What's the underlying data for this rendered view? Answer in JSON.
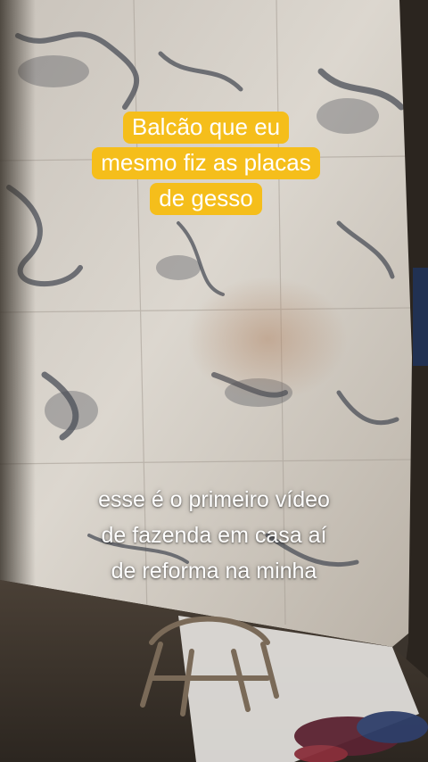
{
  "overlay": {
    "top_caption_lines": [
      "Balcão que eu",
      "mesmo fiz as placas",
      "de gesso"
    ],
    "top_caption_bg": "#f5be1b",
    "bottom_caption_lines": [
      "esse é o primeiro vídeo",
      "de fazenda em casa aí",
      "de reforma na minha"
    ]
  }
}
